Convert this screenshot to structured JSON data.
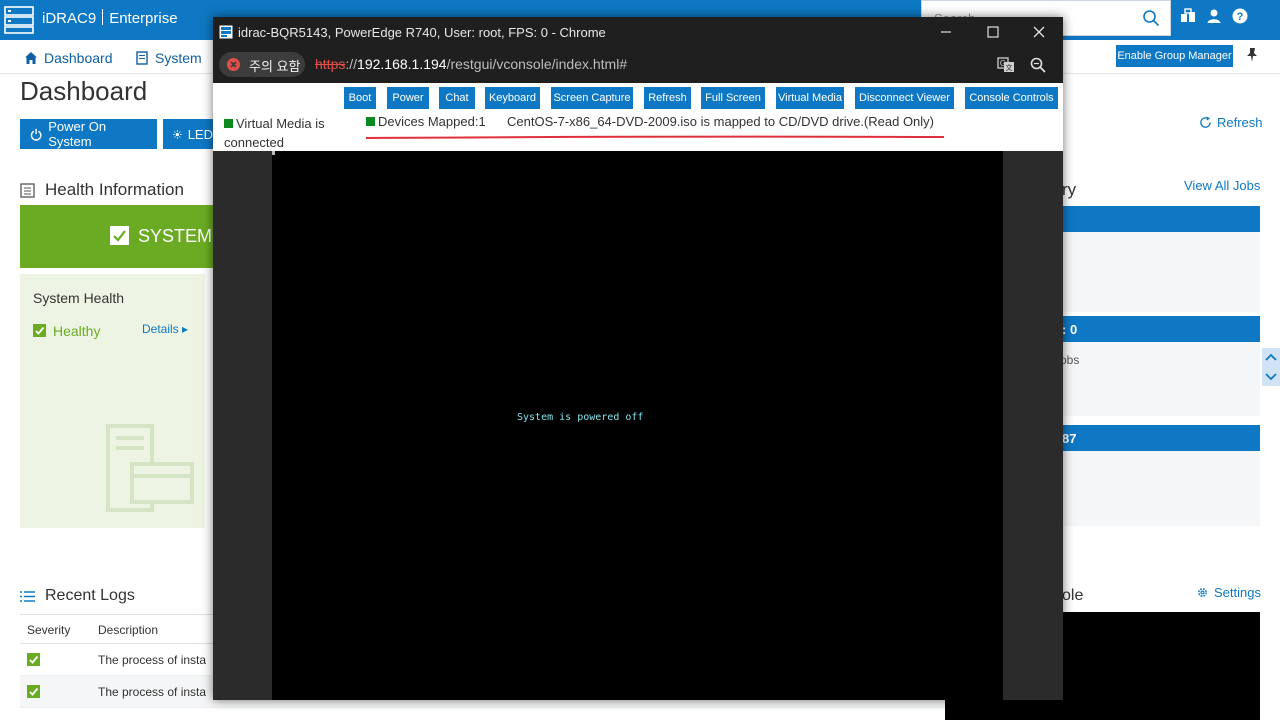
{
  "app": {
    "brand": "iDRAC9",
    "edition": "Enterprise",
    "search_placeholder": "Search"
  },
  "nav": {
    "items": [
      "Dashboard",
      "System"
    ],
    "enable_group_manager": "Enable Group Manager"
  },
  "dashboard": {
    "title": "Dashboard",
    "power_on": "Power On System",
    "led": "LED",
    "refresh": "Refresh",
    "health_information": "Health Information",
    "system_banner": "SYSTEM",
    "system_health": "System Health",
    "healthy": "Healthy",
    "details": "Details",
    "view_all_jobs": "View All Jobs",
    "panel_title_fragment": "ry",
    "bar2_fragment": ": 0",
    "jobs_fragment": "obs",
    "bar3_fragment": "87",
    "console_fragment": "ole",
    "settings": "Settings"
  },
  "logs": {
    "title": "Recent Logs",
    "columns": [
      "Severity",
      "Description"
    ],
    "rows": [
      "The process of insta",
      "The process of insta"
    ]
  },
  "console_window": {
    "title": "idrac-BQR5143, PowerEdge R740, User: root, FPS: 0 - Chrome",
    "warning": "주의 요함",
    "url_scheme": "https",
    "url_sep": "://",
    "url_host": "192.168.1.194",
    "url_path": "/restgui/vconsole/index.html#",
    "toolbar": [
      "Boot",
      "Power",
      "Chat",
      "Keyboard",
      "Screen Capture",
      "Refresh",
      "Full Screen",
      "Virtual Media",
      "Disconnect Viewer",
      "Console Controls"
    ],
    "virtual_media_status": "Virtual Media is connected",
    "devices_mapped": "Devices Mapped:1",
    "iso_message": "CentOS-7-x86_64-DVD-2009.iso is mapped to CD/DVD drive.(Read Only)",
    "screen_message": "System is powered off"
  },
  "colors": {
    "accent": "#0e78c4",
    "healthy_green": "#6aab23",
    "status_green": "#0a8a1e",
    "underline_red": "#e0303a"
  }
}
